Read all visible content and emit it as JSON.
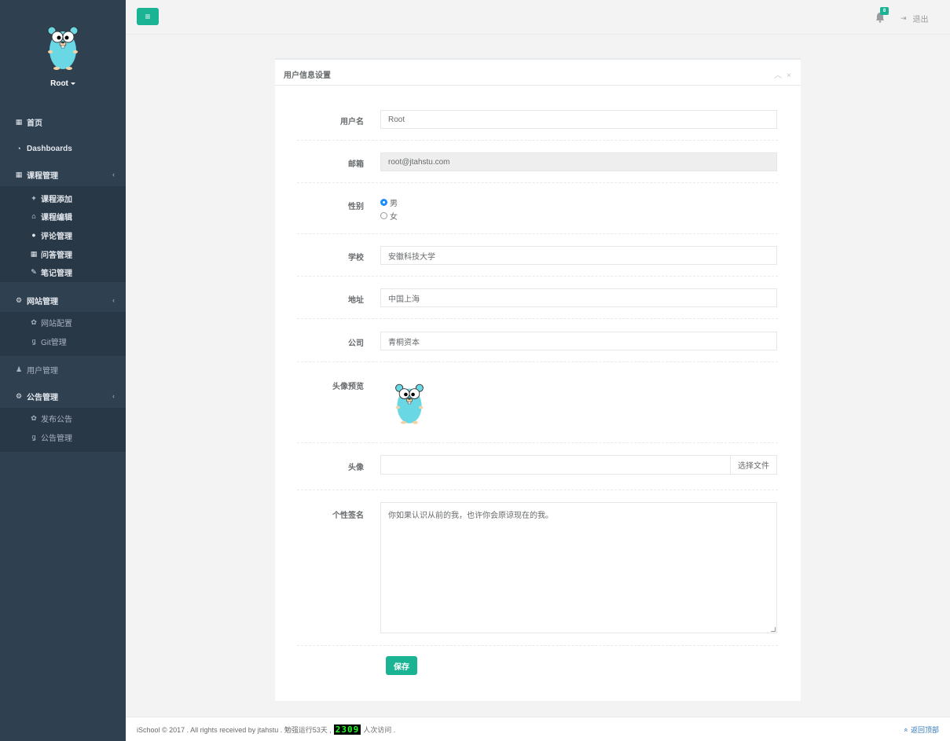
{
  "sidebar": {
    "user_name": "Root",
    "items": [
      {
        "label": "首页",
        "icon": "grid-icon"
      },
      {
        "label": "Dashboards",
        "icon": "dashboard-icon"
      },
      {
        "label": "课程管理",
        "icon": "grid-icon",
        "expanded": true,
        "children": [
          {
            "label": "课程添加",
            "icon": "plus-icon"
          },
          {
            "label": "课程编辑",
            "icon": "graduation-cap-icon"
          },
          {
            "label": "评论管理",
            "icon": "comment-icon"
          },
          {
            "label": "问答管理",
            "icon": "grid-icon"
          },
          {
            "label": "笔记管理",
            "icon": "pencil-icon"
          }
        ]
      },
      {
        "label": "网站管理",
        "icon": "cogs-icon",
        "expanded": true,
        "children": [
          {
            "label": "网站配置",
            "icon": "gear-icon"
          },
          {
            "label": "Git管理",
            "icon": "git-icon"
          }
        ]
      },
      {
        "label": "用户管理",
        "icon": "user-icon"
      },
      {
        "label": "公告管理",
        "icon": "cogs-icon",
        "expanded": true,
        "children": [
          {
            "label": "发布公告",
            "icon": "gear-icon"
          },
          {
            "label": "公告管理",
            "icon": "git-icon"
          }
        ]
      }
    ]
  },
  "topbar": {
    "notification_count": "8",
    "logout_label": "退出"
  },
  "panel": {
    "title": "用户信息设置",
    "fields": {
      "username": {
        "label": "用户名",
        "value": "Root"
      },
      "email": {
        "label": "邮箱",
        "value": "root@jtahstu.com"
      },
      "gender": {
        "label": "性别",
        "options": [
          "男",
          "女"
        ],
        "selected": "男"
      },
      "school": {
        "label": "学校",
        "value": "安徽科技大学"
      },
      "address": {
        "label": "地址",
        "value": "中国上海"
      },
      "company": {
        "label": "公司",
        "value": "青桐资本"
      },
      "avatar_preview": {
        "label": "头像预览"
      },
      "avatar": {
        "label": "头像",
        "button": "选择文件"
      },
      "signature": {
        "label": "个性签名",
        "value": "你如果认识从前的我，也许你会原谅现在的我。"
      }
    },
    "save_label": "保存"
  },
  "footer": {
    "text_before": "iSchool © 2017 . All rights received by jtahstu . 勉强运行53天 ,",
    "counter": "2309",
    "text_after": "人次访问 .",
    "back_to_top": "返回顶部"
  },
  "colors": {
    "sidebar_bg": "#2f4050",
    "accent": "#1ab394",
    "page_bg": "#f3f3f4"
  }
}
